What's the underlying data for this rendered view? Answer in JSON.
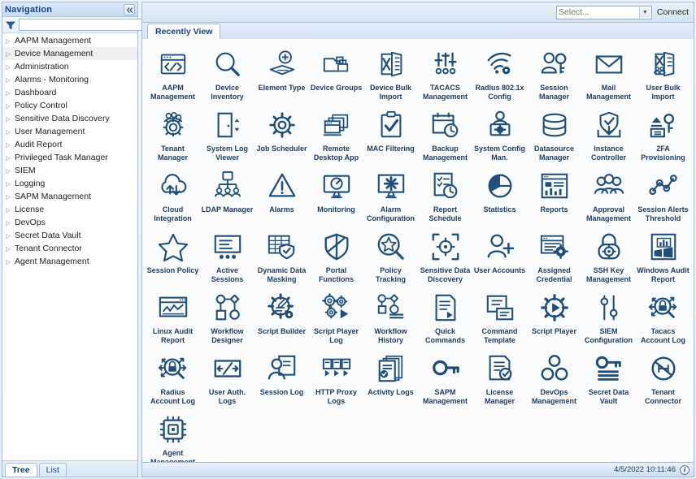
{
  "sidebar": {
    "title": "Navigation",
    "collapse_icon": "chevron-double-left-icon",
    "filter": {
      "value": "",
      "placeholder": "",
      "icon": "filter-icon",
      "clear_icon": "clear-icon"
    },
    "items": [
      {
        "label": "AAPM Management",
        "selected": false
      },
      {
        "label": "Device Management",
        "selected": true
      },
      {
        "label": "Administration",
        "selected": false
      },
      {
        "label": "Alarms - Monitoring",
        "selected": false
      },
      {
        "label": "Dashboard",
        "selected": false
      },
      {
        "label": "Policy Control",
        "selected": false
      },
      {
        "label": "Sensitive Data Discovery",
        "selected": false
      },
      {
        "label": "User Management",
        "selected": false
      },
      {
        "label": "Audit Report",
        "selected": false
      },
      {
        "label": "Privileged Task Manager",
        "selected": false
      },
      {
        "label": "SIEM",
        "selected": false
      },
      {
        "label": "Logging",
        "selected": false
      },
      {
        "label": "SAPM Management",
        "selected": false
      },
      {
        "label": "License",
        "selected": false
      },
      {
        "label": "DevOps",
        "selected": false
      },
      {
        "label": "Secret Data Vault",
        "selected": false
      },
      {
        "label": "Tenant Connector",
        "selected": false
      },
      {
        "label": "Agent Management",
        "selected": false
      }
    ],
    "tabs": [
      {
        "label": "Tree",
        "active": true
      },
      {
        "label": "List",
        "active": false
      }
    ]
  },
  "toolbar": {
    "select_value": "Select...",
    "select_arrow_icon": "chevron-down-icon",
    "connect_label": "Connect"
  },
  "tabs": [
    {
      "label": "Recently View",
      "active": true
    }
  ],
  "tiles": [
    {
      "label": "AAPM Management",
      "icon": "aapm-management-icon"
    },
    {
      "label": "Device Inventory",
      "icon": "magnifier-icon"
    },
    {
      "label": "Element Type",
      "icon": "element-type-icon"
    },
    {
      "label": "Device Groups",
      "icon": "device-groups-icon"
    },
    {
      "label": "Device Bulk Import",
      "icon": "excel-import-icon"
    },
    {
      "label": "TACACS Management",
      "icon": "sliders-icon"
    },
    {
      "label": "Radius 802.1x Config",
      "icon": "wifi-gear-icon"
    },
    {
      "label": "Session Manager",
      "icon": "user-key-icon"
    },
    {
      "label": "Mail Management",
      "icon": "envelope-icon"
    },
    {
      "label": "User Bulk Import",
      "icon": "excel-users-icon"
    },
    {
      "label": "Tenant Manager",
      "icon": "tenant-manager-icon"
    },
    {
      "label": "System Log Viewer",
      "icon": "system-log-viewer-icon"
    },
    {
      "label": "Job Scheduler",
      "icon": "gear-icon"
    },
    {
      "label": "Remote Desktop App",
      "icon": "remote-desktop-icon"
    },
    {
      "label": "MAC Filtering",
      "icon": "clipboard-check-icon"
    },
    {
      "label": "Backup Management",
      "icon": "calendar-clock-icon"
    },
    {
      "label": "System Config Man.",
      "icon": "user-gear-config-icon"
    },
    {
      "label": "Datasource Manager",
      "icon": "database-icon"
    },
    {
      "label": "Instance Controller",
      "icon": "shield-download-icon"
    },
    {
      "label": "2FA Provisioning",
      "icon": "twofa-key-icon"
    },
    {
      "label": "Cloud Integration",
      "icon": "cloud-sync-icon"
    },
    {
      "label": "LDAP Manager",
      "icon": "ldap-tree-icon"
    },
    {
      "label": "Alarms",
      "icon": "warning-triangle-icon"
    },
    {
      "label": "Monitoring",
      "icon": "monitor-gauge-icon"
    },
    {
      "label": "Alarm Configuration",
      "icon": "monitor-gear-icon"
    },
    {
      "label": "Report Schedule",
      "icon": "report-clock-icon"
    },
    {
      "label": "Statistics",
      "icon": "pie-chart-icon"
    },
    {
      "label": "Reports",
      "icon": "reports-icon"
    },
    {
      "label": "Approval Management",
      "icon": "people-group-icon"
    },
    {
      "label": "Session Alerts Threshold",
      "icon": "node-graph-icon"
    },
    {
      "label": "Session Policy",
      "icon": "star-icon"
    },
    {
      "label": "Active Sessions",
      "icon": "active-sessions-icon"
    },
    {
      "label": "Dynamic Data Masking",
      "icon": "grid-shield-icon"
    },
    {
      "label": "Portal Functions",
      "icon": "shield-split-icon"
    },
    {
      "label": "Policy Tracking",
      "icon": "star-magnifier-icon"
    },
    {
      "label": "Sensitive Data Discovery",
      "icon": "target-scan-icon"
    },
    {
      "label": "User Accounts",
      "icon": "user-plus-icon"
    },
    {
      "label": "Assigned Credential",
      "icon": "window-gear-icon"
    },
    {
      "label": "SSH Key Management",
      "icon": "lock-target-icon"
    },
    {
      "label": "Windows Audit Report",
      "icon": "windows-report-icon"
    },
    {
      "label": "Linux Audit Report",
      "icon": "window-chart-icon"
    },
    {
      "label": "Workflow Designer",
      "icon": "workflow-nodes-icon"
    },
    {
      "label": "Script Builder",
      "icon": "gear-pencil-icon"
    },
    {
      "label": "Script Player Log",
      "icon": "gears-play-icon"
    },
    {
      "label": "Workflow History",
      "icon": "workflow-history-icon"
    },
    {
      "label": "Quick Commands",
      "icon": "doc-play-icon"
    },
    {
      "label": "Command Template",
      "icon": "command-template-icon"
    },
    {
      "label": "Script Player",
      "icon": "gear-play-icon"
    },
    {
      "label": "SIEM Configuration",
      "icon": "siem-sliders-icon"
    },
    {
      "label": "Tacacs Account Log",
      "icon": "lock-magnifier-icon"
    },
    {
      "label": "Radius Account Log",
      "icon": "lock-magnifier-icon"
    },
    {
      "label": "User Auth. Logs",
      "icon": "auth-arrows-icon"
    },
    {
      "label": "Session Log",
      "icon": "user-doc-icon"
    },
    {
      "label": "HTTP Proxy Logs",
      "icon": "proxy-play-icon"
    },
    {
      "label": "Activity Logs",
      "icon": "docs-check-icon"
    },
    {
      "label": "SAPM Management",
      "icon": "key-icon"
    },
    {
      "label": "License Manager",
      "icon": "doc-check-icon"
    },
    {
      "label": "DevOps Management",
      "icon": "devops-infinity-icon"
    },
    {
      "label": "Secret Data Vault",
      "icon": "key-lines-icon"
    },
    {
      "label": "Tenant Connector",
      "icon": "connector-icon"
    },
    {
      "label": "Agent Management",
      "icon": "chip-icon"
    }
  ],
  "status": {
    "timestamp": "4/5/2022 10:11:46",
    "info_icon": "info-icon",
    "info_label": "i"
  },
  "colors": {
    "icon_stroke": "#1f4e79",
    "icon_accent": "#2a6099",
    "header_text": "#15428b",
    "panel_border": "#a3bdd8"
  }
}
